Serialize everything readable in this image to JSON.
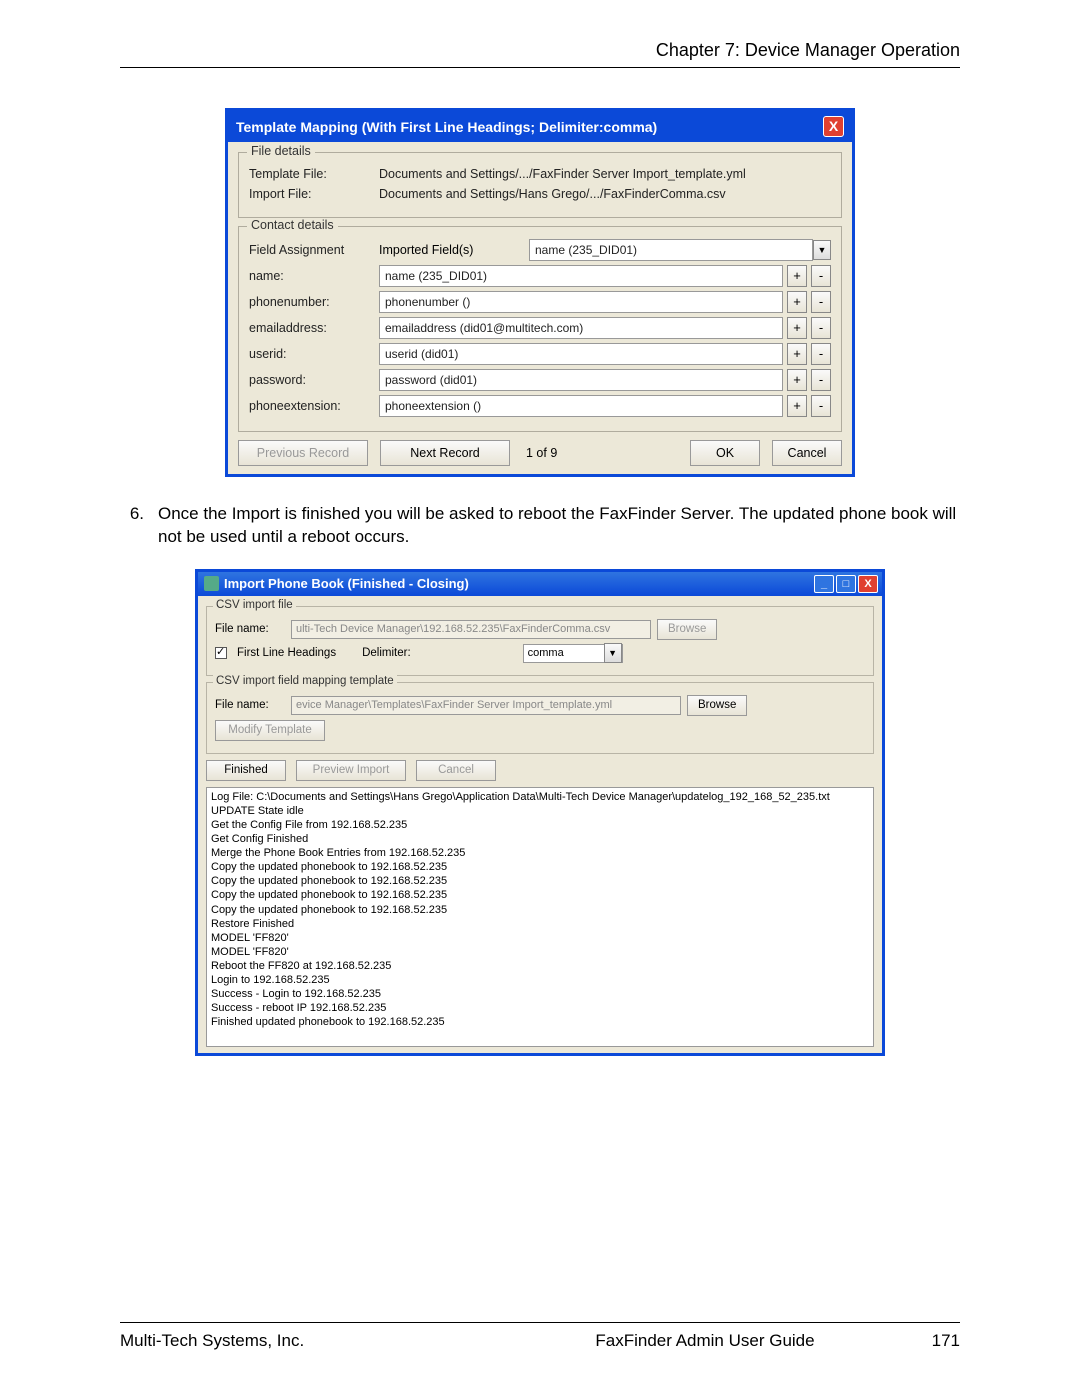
{
  "page_header": "Chapter 7: Device Manager Operation",
  "dlg1": {
    "title": "Template Mapping (With First Line Headings; Delimiter:comma)",
    "file_details_legend": "File details",
    "template_file_label": "Template File:",
    "template_file_value": "Documents and Settings/.../FaxFinder Server Import_template.yml",
    "import_file_label": "Import File:",
    "import_file_value": "Documents and Settings/Hans Grego/.../FaxFinderComma.csv",
    "contact_details_legend": "Contact details",
    "field_assign_label": "Field Assignment",
    "imported_fields_label": "Imported Field(s)",
    "imported_select": "name (235_DID01)",
    "rows": [
      {
        "label": "name:",
        "value": "name (235_DID01)"
      },
      {
        "label": "phonenumber:",
        "value": "phonenumber ()"
      },
      {
        "label": "emailaddress:",
        "value": "emailaddress (did01@multitech.com)"
      },
      {
        "label": "userid:",
        "value": "userid (did01)"
      },
      {
        "label": "password:",
        "value": "password (did01)"
      },
      {
        "label": "phoneextension:",
        "value": "phoneextension ()"
      }
    ],
    "prev_btn": "Previous Record",
    "next_btn": "Next Record",
    "page_counter": "1 of 9",
    "ok_btn": "OK",
    "cancel_btn": "Cancel"
  },
  "step6": {
    "num": "6.",
    "text": "Once the Import is finished you will be asked to reboot the FaxFinder Server. The updated phone book will not be used until a reboot occurs."
  },
  "dlg2": {
    "title": "Import Phone Book (Finished - Closing)",
    "csv_legend": "CSV import file",
    "fn_label": "File name:",
    "fn_value": "ulti-Tech Device Manager\\192.168.52.235\\FaxFinderComma.csv",
    "browse": "Browse",
    "first_line": "First Line Headings",
    "delim_label": "Delimiter:",
    "delim_value": "comma",
    "map_legend": "CSV import field mapping template",
    "map_fn_value": "evice Manager\\Templates\\FaxFinder Server Import_template.yml",
    "modify_btn": "Modify Template",
    "finished_btn": "Finished",
    "preview_btn": "Preview Import",
    "cancel_btn": "Cancel",
    "log_lines": [
      "Log File: C:\\Documents and Settings\\Hans Grego\\Application Data\\Multi-Tech Device Manager\\updatelog_192_168_52_235.txt",
      "UPDATE State idle",
      "Get the Config File from 192.168.52.235",
      "Get Config Finished",
      "Merge the Phone Book Entries from 192.168.52.235",
      "Copy the updated phonebook to 192.168.52.235",
      "Copy the updated phonebook to 192.168.52.235",
      "Copy the updated phonebook to 192.168.52.235",
      "Copy the updated phonebook to 192.168.52.235",
      "Restore Finished",
      "MODEL 'FF820'",
      "MODEL 'FF820'",
      "Reboot the FF820 at 192.168.52.235",
      "Login to 192.168.52.235",
      "Success - Login to 192.168.52.235",
      "Success - reboot IP 192.168.52.235",
      "Finished updated phonebook to 192.168.52.235"
    ]
  },
  "footer": {
    "left": "Multi-Tech Systems, Inc.",
    "center": "FaxFinder Admin User Guide",
    "right": "171"
  }
}
